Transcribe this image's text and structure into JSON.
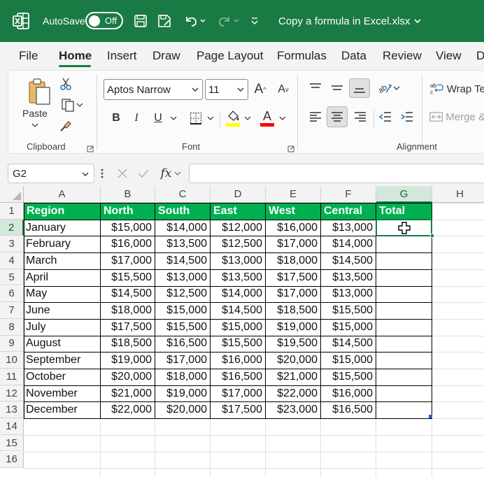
{
  "titlebar": {
    "autosave_label": "AutoSave",
    "autosave_state": "Off",
    "document_title": "Copy a formula in Excel.xlsx",
    "accent_color": "#1a7a43"
  },
  "tabs": [
    {
      "label": "File",
      "active": false
    },
    {
      "label": "Home",
      "active": true
    },
    {
      "label": "Insert",
      "active": false
    },
    {
      "label": "Draw",
      "active": false
    },
    {
      "label": "Page Layout",
      "active": false
    },
    {
      "label": "Formulas",
      "active": false
    },
    {
      "label": "Data",
      "active": false
    },
    {
      "label": "Review",
      "active": false
    },
    {
      "label": "View",
      "active": false
    },
    {
      "label": "D",
      "active": false
    }
  ],
  "ribbon": {
    "clipboard": {
      "paste_label": "Paste",
      "group_label": "Clipboard"
    },
    "font": {
      "font_name": "Aptos Narrow",
      "font_size": "11",
      "group_label": "Font",
      "bold": "B",
      "italic": "I",
      "underline": "U",
      "font_color_glyph": "A",
      "fill_color": "#ffff00",
      "font_color": "#ff0000"
    },
    "alignment": {
      "wrap_text": "Wrap Te",
      "merge": "Merge &",
      "group_label": "Alignment"
    }
  },
  "formula_bar": {
    "name_box": "G2",
    "fx_label": "fx",
    "formula": ""
  },
  "grid": {
    "columns": [
      "A",
      "B",
      "C",
      "D",
      "E",
      "F",
      "G",
      "H"
    ],
    "rows": [
      "1",
      "2",
      "3",
      "4",
      "5",
      "6",
      "7",
      "8",
      "9",
      "10",
      "11",
      "12",
      "13",
      "14",
      "15",
      "16"
    ],
    "active_cell": "G2",
    "header_row": [
      "Region",
      "North",
      "South",
      "East",
      "West",
      "Central",
      "Total"
    ],
    "header_fill": "#00b050",
    "data": [
      [
        "January",
        "$15,000",
        "$14,000",
        "$12,000",
        "$16,000",
        "$13,000",
        ""
      ],
      [
        "February",
        "$16,000",
        "$13,500",
        "$12,500",
        "$17,000",
        "$14,000",
        ""
      ],
      [
        "March",
        "$17,000",
        "$14,500",
        "$13,000",
        "$18,000",
        "$14,500",
        ""
      ],
      [
        "April",
        "$15,500",
        "$13,000",
        "$13,500",
        "$17,500",
        "$13,500",
        ""
      ],
      [
        "May",
        "$14,500",
        "$12,500",
        "$14,000",
        "$17,000",
        "$13,000",
        ""
      ],
      [
        "June",
        "$18,000",
        "$15,000",
        "$14,500",
        "$18,500",
        "$15,500",
        ""
      ],
      [
        "July",
        "$17,500",
        "$15,500",
        "$15,000",
        "$19,000",
        "$15,000",
        ""
      ],
      [
        "August",
        "$18,500",
        "$16,500",
        "$15,500",
        "$19,500",
        "$14,500",
        ""
      ],
      [
        "September",
        "$19,000",
        "$17,000",
        "$16,000",
        "$20,000",
        "$15,000",
        ""
      ],
      [
        "October",
        "$20,000",
        "$18,000",
        "$16,500",
        "$21,000",
        "$15,500",
        ""
      ],
      [
        "November",
        "$21,000",
        "$19,000",
        "$17,000",
        "$22,000",
        "$16,000",
        ""
      ],
      [
        "December",
        "$22,000",
        "$20,000",
        "$17,500",
        "$23,000",
        "$16,500",
        ""
      ]
    ]
  }
}
